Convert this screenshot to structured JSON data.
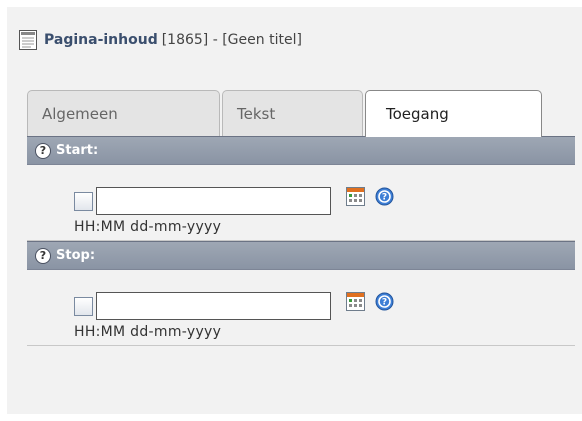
{
  "header": {
    "title_strong": "Pagina-inhoud",
    "title_rest": "[1865] - [Geen titel]",
    "icon": "page-content-icon"
  },
  "tabs": [
    {
      "label": "Algemeen",
      "active": false
    },
    {
      "label": "Tekst",
      "active": false
    },
    {
      "label": "Toegang",
      "active": true
    }
  ],
  "sections": [
    {
      "label": "Start:",
      "help_glyph": "?",
      "input_value": "",
      "format_hint": "HH:MM dd-mm-yyyy",
      "checked": false
    },
    {
      "label": "Stop:",
      "help_glyph": "?",
      "input_value": "",
      "format_hint": "HH:MM dd-mm-yyyy",
      "checked": false
    }
  ],
  "colors": {
    "section_bar": "#929cab",
    "panel_bg": "#f2f2f2",
    "title": "#3b4f6e"
  }
}
